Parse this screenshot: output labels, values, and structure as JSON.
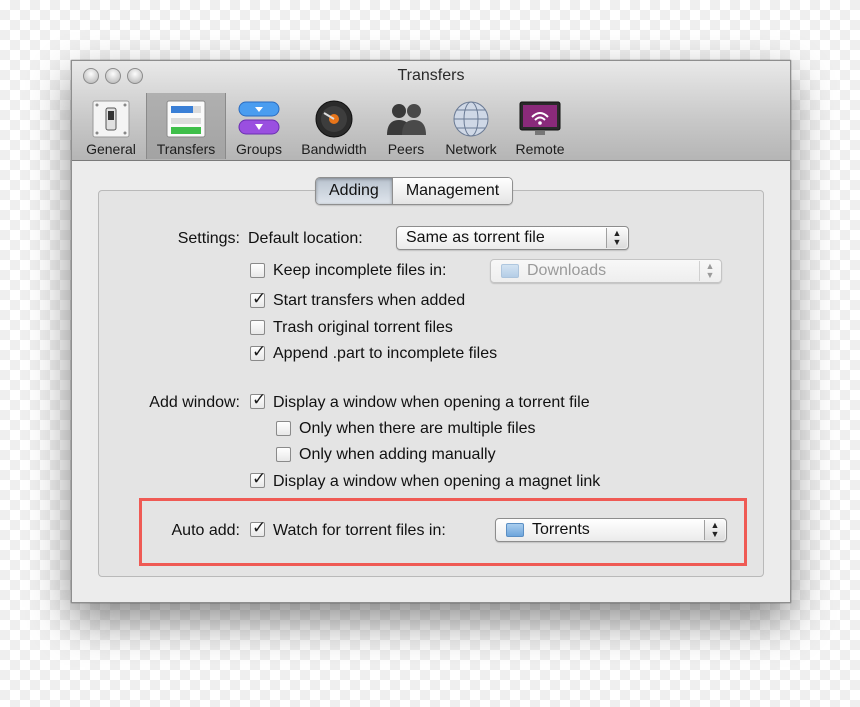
{
  "window": {
    "title": "Transfers"
  },
  "toolbar": {
    "items": [
      {
        "label": "General",
        "icon": "general-switch-icon"
      },
      {
        "label": "Transfers",
        "icon": "transfers-icon",
        "selected": true
      },
      {
        "label": "Groups",
        "icon": "groups-icon"
      },
      {
        "label": "Bandwidth",
        "icon": "bandwidth-icon"
      },
      {
        "label": "Peers",
        "icon": "peers-icon"
      },
      {
        "label": "Network",
        "icon": "network-icon"
      },
      {
        "label": "Remote",
        "icon": "remote-icon"
      }
    ]
  },
  "tabs": {
    "items": [
      {
        "label": "Adding",
        "active": true
      },
      {
        "label": "Management",
        "active": false
      }
    ]
  },
  "settings": {
    "label": "Settings:",
    "default_location_label": "Default location:",
    "default_location_value": "Same as torrent file",
    "keep_incomplete": {
      "label": "Keep incomplete files in:",
      "checked": false,
      "folder": "Downloads"
    },
    "start_transfers": {
      "label": "Start transfers when added",
      "checked": true
    },
    "trash_original": {
      "label": "Trash original torrent files",
      "checked": false
    },
    "append_part": {
      "label": "Append .part to incomplete files",
      "checked": true
    }
  },
  "add_window": {
    "label": "Add window:",
    "display_window": {
      "label": "Display a window when opening a torrent file",
      "checked": true
    },
    "only_multiple": {
      "label": "Only when there are multiple files",
      "checked": false
    },
    "only_manual": {
      "label": "Only when adding manually",
      "checked": false
    },
    "display_magnet": {
      "label": "Display a window when opening a magnet link",
      "checked": true
    }
  },
  "auto_add": {
    "label": "Auto add:",
    "watch": {
      "label": "Watch for torrent files in:",
      "checked": true
    },
    "folder": "Torrents"
  },
  "colors": {
    "highlight": "#ef5a54",
    "accent": "#2a5fb8"
  }
}
